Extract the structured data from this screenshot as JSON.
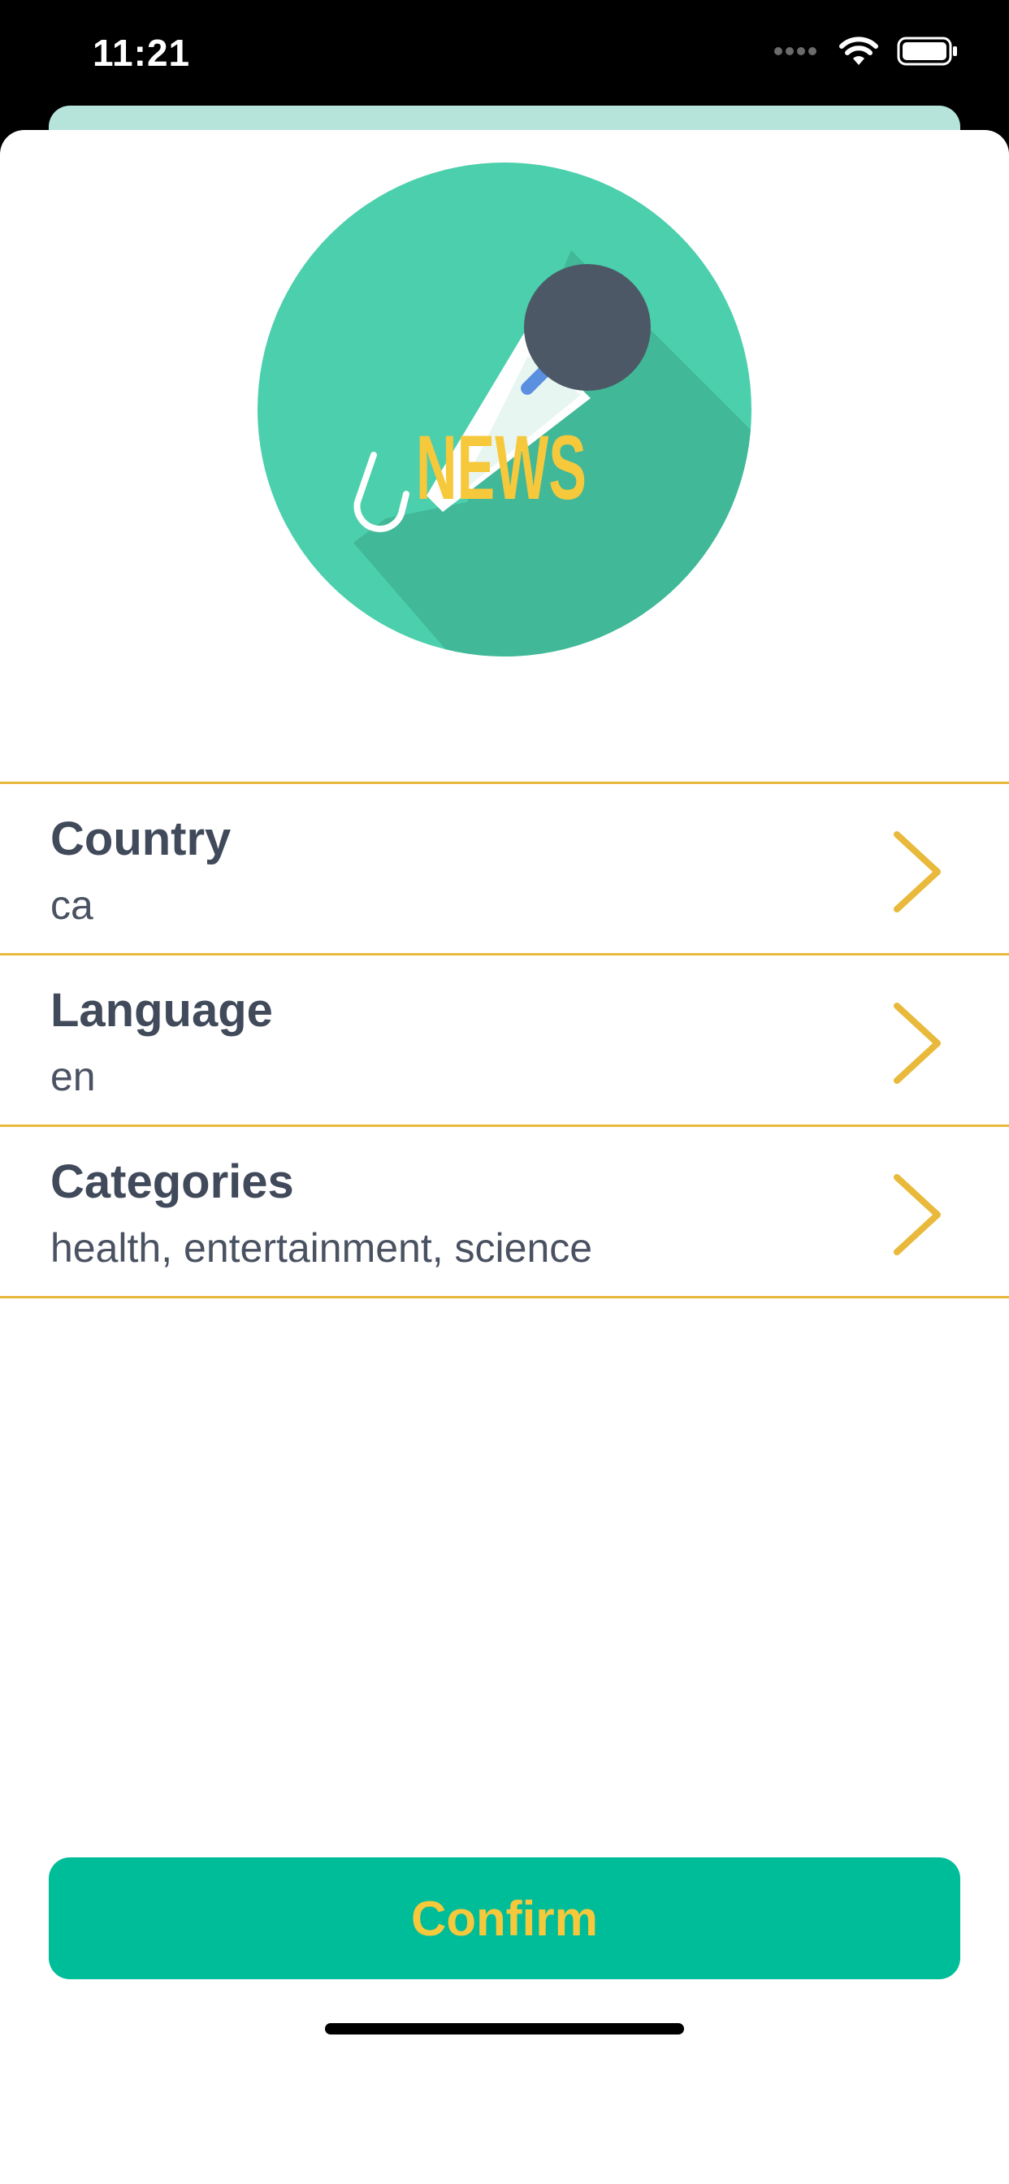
{
  "status_bar": {
    "time": "11:21",
    "icons": [
      "signal-dots-icon",
      "wifi-icon",
      "battery-icon"
    ]
  },
  "logo": {
    "text": "NEWS",
    "colors": {
      "circle": "#4bcfac",
      "shadow": "#41b898",
      "mic_head": "#4d5866",
      "text": "#f6c83c",
      "accent": "#5b8fe0"
    }
  },
  "settings": {
    "items": [
      {
        "label": "Country",
        "value": "ca",
        "icon": "chevron-right-icon"
      },
      {
        "label": "Language",
        "value": "en",
        "icon": "chevron-right-icon"
      },
      {
        "label": "Categories",
        "value": "health, entertainment, science",
        "icon": "chevron-right-icon"
      }
    ]
  },
  "confirm": {
    "label": "Confirm"
  },
  "colors": {
    "accent": "#e8b93a",
    "button_bg": "#00bd99",
    "button_text": "#f6c83c",
    "title_text": "#414a5a"
  }
}
